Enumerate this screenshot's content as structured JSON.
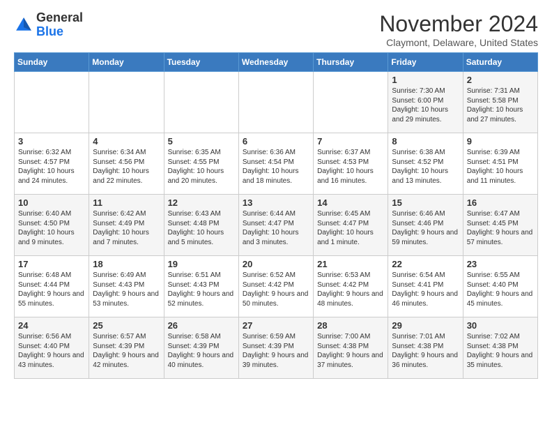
{
  "header": {
    "logo_general": "General",
    "logo_blue": "Blue",
    "month_title": "November 2024",
    "subtitle": "Claymont, Delaware, United States"
  },
  "days_of_week": [
    "Sunday",
    "Monday",
    "Tuesday",
    "Wednesday",
    "Thursday",
    "Friday",
    "Saturday"
  ],
  "weeks": [
    [
      {
        "day": "",
        "info": ""
      },
      {
        "day": "",
        "info": ""
      },
      {
        "day": "",
        "info": ""
      },
      {
        "day": "",
        "info": ""
      },
      {
        "day": "",
        "info": ""
      },
      {
        "day": "1",
        "info": "Sunrise: 7:30 AM\nSunset: 6:00 PM\nDaylight: 10 hours and 29 minutes."
      },
      {
        "day": "2",
        "info": "Sunrise: 7:31 AM\nSunset: 5:58 PM\nDaylight: 10 hours and 27 minutes."
      }
    ],
    [
      {
        "day": "3",
        "info": "Sunrise: 6:32 AM\nSunset: 4:57 PM\nDaylight: 10 hours and 24 minutes."
      },
      {
        "day": "4",
        "info": "Sunrise: 6:34 AM\nSunset: 4:56 PM\nDaylight: 10 hours and 22 minutes."
      },
      {
        "day": "5",
        "info": "Sunrise: 6:35 AM\nSunset: 4:55 PM\nDaylight: 10 hours and 20 minutes."
      },
      {
        "day": "6",
        "info": "Sunrise: 6:36 AM\nSunset: 4:54 PM\nDaylight: 10 hours and 18 minutes."
      },
      {
        "day": "7",
        "info": "Sunrise: 6:37 AM\nSunset: 4:53 PM\nDaylight: 10 hours and 16 minutes."
      },
      {
        "day": "8",
        "info": "Sunrise: 6:38 AM\nSunset: 4:52 PM\nDaylight: 10 hours and 13 minutes."
      },
      {
        "day": "9",
        "info": "Sunrise: 6:39 AM\nSunset: 4:51 PM\nDaylight: 10 hours and 11 minutes."
      }
    ],
    [
      {
        "day": "10",
        "info": "Sunrise: 6:40 AM\nSunset: 4:50 PM\nDaylight: 10 hours and 9 minutes."
      },
      {
        "day": "11",
        "info": "Sunrise: 6:42 AM\nSunset: 4:49 PM\nDaylight: 10 hours and 7 minutes."
      },
      {
        "day": "12",
        "info": "Sunrise: 6:43 AM\nSunset: 4:48 PM\nDaylight: 10 hours and 5 minutes."
      },
      {
        "day": "13",
        "info": "Sunrise: 6:44 AM\nSunset: 4:47 PM\nDaylight: 10 hours and 3 minutes."
      },
      {
        "day": "14",
        "info": "Sunrise: 6:45 AM\nSunset: 4:47 PM\nDaylight: 10 hours and 1 minute."
      },
      {
        "day": "15",
        "info": "Sunrise: 6:46 AM\nSunset: 4:46 PM\nDaylight: 9 hours and 59 minutes."
      },
      {
        "day": "16",
        "info": "Sunrise: 6:47 AM\nSunset: 4:45 PM\nDaylight: 9 hours and 57 minutes."
      }
    ],
    [
      {
        "day": "17",
        "info": "Sunrise: 6:48 AM\nSunset: 4:44 PM\nDaylight: 9 hours and 55 minutes."
      },
      {
        "day": "18",
        "info": "Sunrise: 6:49 AM\nSunset: 4:43 PM\nDaylight: 9 hours and 53 minutes."
      },
      {
        "day": "19",
        "info": "Sunrise: 6:51 AM\nSunset: 4:43 PM\nDaylight: 9 hours and 52 minutes."
      },
      {
        "day": "20",
        "info": "Sunrise: 6:52 AM\nSunset: 4:42 PM\nDaylight: 9 hours and 50 minutes."
      },
      {
        "day": "21",
        "info": "Sunrise: 6:53 AM\nSunset: 4:42 PM\nDaylight: 9 hours and 48 minutes."
      },
      {
        "day": "22",
        "info": "Sunrise: 6:54 AM\nSunset: 4:41 PM\nDaylight: 9 hours and 46 minutes."
      },
      {
        "day": "23",
        "info": "Sunrise: 6:55 AM\nSunset: 4:40 PM\nDaylight: 9 hours and 45 minutes."
      }
    ],
    [
      {
        "day": "24",
        "info": "Sunrise: 6:56 AM\nSunset: 4:40 PM\nDaylight: 9 hours and 43 minutes."
      },
      {
        "day": "25",
        "info": "Sunrise: 6:57 AM\nSunset: 4:39 PM\nDaylight: 9 hours and 42 minutes."
      },
      {
        "day": "26",
        "info": "Sunrise: 6:58 AM\nSunset: 4:39 PM\nDaylight: 9 hours and 40 minutes."
      },
      {
        "day": "27",
        "info": "Sunrise: 6:59 AM\nSunset: 4:39 PM\nDaylight: 9 hours and 39 minutes."
      },
      {
        "day": "28",
        "info": "Sunrise: 7:00 AM\nSunset: 4:38 PM\nDaylight: 9 hours and 37 minutes."
      },
      {
        "day": "29",
        "info": "Sunrise: 7:01 AM\nSunset: 4:38 PM\nDaylight: 9 hours and 36 minutes."
      },
      {
        "day": "30",
        "info": "Sunrise: 7:02 AM\nSunset: 4:38 PM\nDaylight: 9 hours and 35 minutes."
      }
    ]
  ]
}
